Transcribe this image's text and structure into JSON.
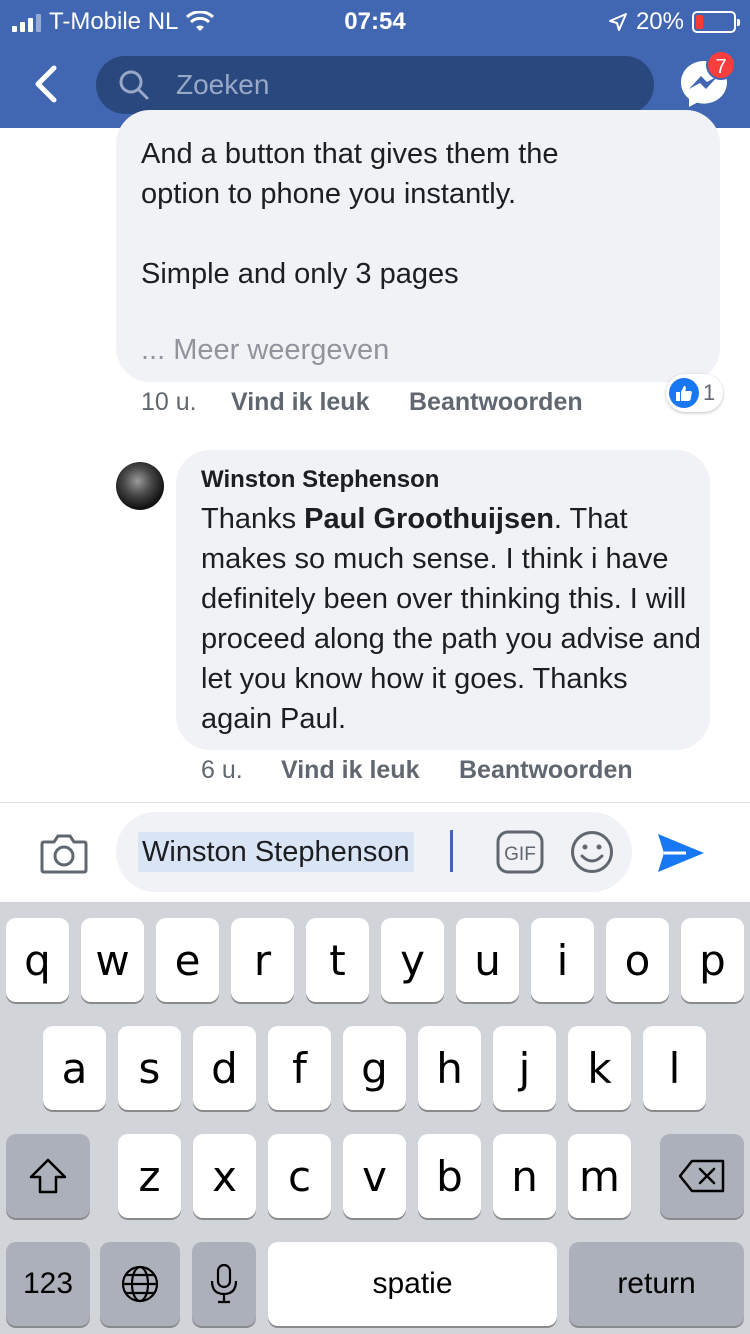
{
  "status_bar": {
    "carrier": "T-Mobile NL",
    "time": "07:54",
    "battery": "20%"
  },
  "header": {
    "search_placeholder": "Zoeken",
    "messenger_badge": "7"
  },
  "comments": [
    {
      "text_lines": [
        "And a button that gives them the",
        "option to phone you instantly.",
        "",
        "Simple and only 3 pages"
      ],
      "more": "... Meer weergeven",
      "time": "10 u.",
      "like": "Vind ik leuk",
      "reply": "Beantwoorden",
      "reaction_count": "1"
    },
    {
      "author": "Winston Stephenson",
      "text_prefix": "Thanks ",
      "mention": "Paul Groothuijsen",
      "text_suffix": ". That makes so much sense. I think i have definitely been over thinking this. I will proceed along the path you advise and let you know how it goes. Thanks again Paul.",
      "time": "6 u.",
      "like": "Vind ik leuk",
      "reply": "Beantwoorden"
    }
  ],
  "composer": {
    "value": "Winston Stephenson",
    "gif_label": "GIF"
  },
  "keyboard": {
    "row1": [
      "q",
      "w",
      "e",
      "r",
      "t",
      "y",
      "u",
      "i",
      "o",
      "p"
    ],
    "row2": [
      "a",
      "s",
      "d",
      "f",
      "g",
      "h",
      "j",
      "k",
      "l"
    ],
    "row3": [
      "z",
      "x",
      "c",
      "v",
      "b",
      "n",
      "m"
    ],
    "numbers": "123",
    "space": "spatie",
    "return": "return"
  }
}
